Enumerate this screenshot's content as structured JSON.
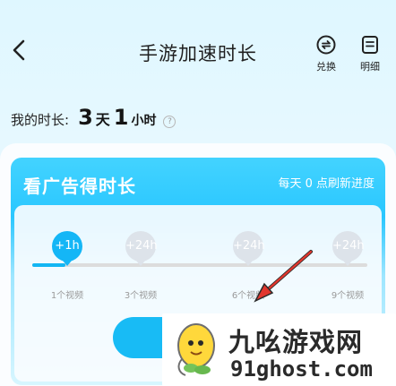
{
  "header": {
    "title": "手游加速时长",
    "exchange_label": "兑换",
    "detail_label": "明细"
  },
  "summary": {
    "label": "我的时长:",
    "days": "3",
    "day_unit": "天",
    "hours": "1",
    "hour_unit": "小时"
  },
  "ad_reward": {
    "title": "看广告得时长",
    "subtitle": "每天 0 点刷新进度",
    "progress_fraction": 0.1,
    "milestones": [
      {
        "reward": "+1h",
        "videos": "1个视频",
        "active": true
      },
      {
        "reward": "+24h",
        "videos": "3个视频",
        "active": false
      },
      {
        "reward": "+24h",
        "videos": "6个视频",
        "active": false
      },
      {
        "reward": "+24h",
        "videos": "9个视频",
        "active": false
      }
    ]
  },
  "watermark": {
    "name": "九吆游戏网",
    "url": "91ghost.com"
  },
  "colors": {
    "accent": "#14b6f6",
    "title_bar_blue": "#2ac7ff",
    "arrow_red": "#e1362d"
  },
  "icons": {
    "back": "back-chevron-icon",
    "exchange": "exchange-icon",
    "detail": "detail-icon",
    "help": "help-icon",
    "logo": "mascot-logo-icon"
  }
}
